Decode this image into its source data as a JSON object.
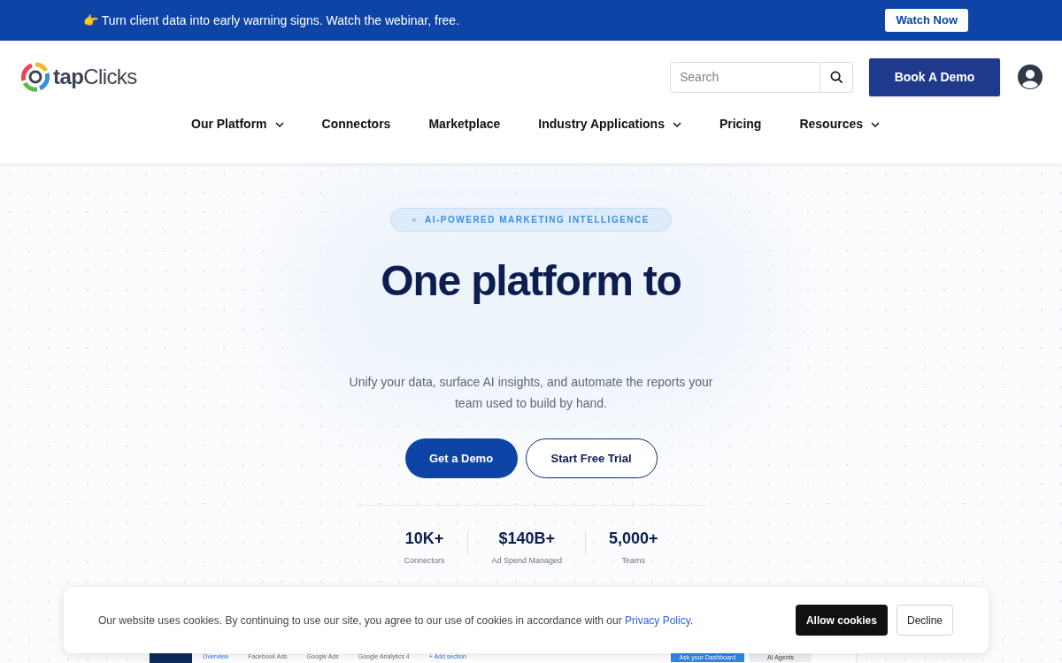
{
  "announcement": {
    "icon": "👉",
    "text": "Turn client data into early warning signs. Watch the webinar, free.",
    "button": "Watch Now"
  },
  "header": {
    "logo": {
      "part_1": "tap",
      "part_2": "Clicks"
    },
    "search": {
      "placeholder": "Search"
    },
    "cta": "Book A Demo"
  },
  "nav": [
    {
      "label": "Our Platform",
      "dropdown": true
    },
    {
      "label": "Connectors",
      "dropdown": false
    },
    {
      "label": "Marketplace",
      "dropdown": false
    },
    {
      "label": "Industry Applications",
      "dropdown": true
    },
    {
      "label": "Pricing",
      "dropdown": false
    },
    {
      "label": "Resources",
      "dropdown": true
    }
  ],
  "hero": {
    "badge": "AI-POWERED MARKETING INTELLIGENCE",
    "title": "One platform to",
    "subtitle": "Unify your data, surface AI insights, and automate the reports your team used to build by hand.",
    "buttons": [
      {
        "label": "Get a Demo",
        "kind": "primary"
      },
      {
        "label": "Start Free Trial",
        "kind": "outline"
      }
    ],
    "stats": [
      {
        "value": "10K+",
        "label": "Connectors"
      },
      {
        "value": "$140B+",
        "label": "Ad Spend Managed"
      },
      {
        "value": "5,000+",
        "label": "Teams"
      }
    ]
  },
  "dashboard_preview": {
    "tabs": [
      "Overview",
      "Facebook Ads",
      "Google Ads",
      "Google Analytics 4",
      "+ Add section"
    ],
    "ask_button": "Ask your Dashboard",
    "agents_tab": "AI Agents"
  },
  "cookie_banner": {
    "text": "Our website uses cookies. By continuing to use our site, you agree to our use of cookies in accordance with our ",
    "link": "Privacy Policy",
    "text_end": ".",
    "accept": "Allow cookies",
    "decline": "Decline"
  }
}
